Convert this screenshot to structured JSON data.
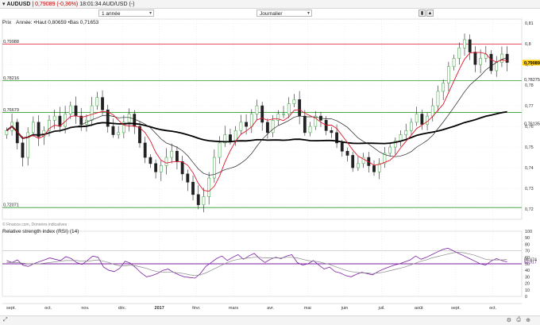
{
  "header": {
    "symbol": "AUDUSD",
    "price": "0,79089",
    "change": "(-0,36%)",
    "time": "18:01:34",
    "instrument": "AUD/USD (-)"
  },
  "toolbar": {
    "period_select": "1 année",
    "interval_select": "Journalier"
  },
  "legend": {
    "label": "Prix",
    "info": "Année: •Haut 0,80659 •Bas 0,71653"
  },
  "watermark": "© Finance.com, Données indicatives",
  "rsi_title": "Relative strength index (RSI) (14)",
  "colors": {
    "candle_up": "#4caf50",
    "candle_down": "#222222",
    "ma_fast": "#e0162b",
    "ma_mid": "#222222",
    "ma_slow": "#000000",
    "support_line": "#2e9b2e",
    "resistance_line": "#e0162b",
    "rsi_line": "#7b1fa2",
    "rsi_signal": "#888888",
    "price_badge": "#ffcc00",
    "ma_badge": "#e0162b"
  },
  "chart_data": [
    {
      "type": "candlestick",
      "title": "AUDUSD",
      "x_labels": [
        "sept.",
        "oct.",
        "nov.",
        "déc.",
        "2017",
        "févr.",
        "mars",
        "avr.",
        "mai",
        "juin",
        "juil.",
        "août",
        "sept.",
        "oct."
      ],
      "y_ticks": [
        "0,81",
        "0,8",
        "0,79",
        "0,78",
        "0,77",
        "0,76",
        "0,75",
        "0,74",
        "0,73",
        "0,72"
      ],
      "ylim": [
        0.715,
        0.812
      ],
      "hlines": [
        {
          "value": 0.79988,
          "label": "0,79988",
          "color": "resistance"
        },
        {
          "value": 0.78216,
          "label": "0,78216",
          "color": "support"
        },
        {
          "value": 0.76679,
          "label": "0,76679",
          "color": "support"
        },
        {
          "value": 0.72071,
          "label": "0,72071",
          "color": "support"
        }
      ],
      "right_badges": [
        {
          "value": 0.79146,
          "label": "0,79146",
          "kind": "ma"
        },
        {
          "value": 0.79089,
          "label": "0,79089",
          "kind": "price"
        },
        {
          "value": 0.78275,
          "label": "0,78275",
          "kind": "plain"
        },
        {
          "value": 0.76135,
          "label": "0,76135",
          "kind": "plain"
        }
      ],
      "closes": [
        0.758,
        0.762,
        0.752,
        0.745,
        0.757,
        0.762,
        0.755,
        0.758,
        0.763,
        0.765,
        0.76,
        0.766,
        0.77,
        0.765,
        0.761,
        0.763,
        0.77,
        0.774,
        0.768,
        0.76,
        0.756,
        0.757,
        0.762,
        0.766,
        0.76,
        0.752,
        0.745,
        0.742,
        0.738,
        0.741,
        0.745,
        0.748,
        0.743,
        0.737,
        0.733,
        0.727,
        0.722,
        0.726,
        0.735,
        0.745,
        0.752,
        0.756,
        0.753,
        0.758,
        0.762,
        0.76,
        0.766,
        0.77,
        0.762,
        0.757,
        0.763,
        0.766,
        0.766,
        0.771,
        0.773,
        0.765,
        0.757,
        0.76,
        0.765,
        0.763,
        0.758,
        0.757,
        0.752,
        0.748,
        0.746,
        0.74,
        0.742,
        0.745,
        0.741,
        0.738,
        0.742,
        0.747,
        0.75,
        0.753,
        0.756,
        0.758,
        0.762,
        0.766,
        0.761,
        0.765,
        0.77,
        0.777,
        0.781,
        0.789,
        0.793,
        0.798,
        0.802,
        0.796,
        0.79,
        0.793,
        0.795,
        0.787,
        0.791,
        0.795,
        0.791
      ]
    },
    {
      "type": "line",
      "title": "Relative strength index (RSI) (14)",
      "y_ticks": [
        "100",
        "90",
        "80",
        "70",
        "60",
        "50",
        "40",
        "30",
        "20",
        "10",
        "0"
      ],
      "ylim": [
        0,
        100
      ],
      "hlines": [
        {
          "value": 70
        },
        {
          "value": 50,
          "highlight": true
        }
      ],
      "right_badges": [
        {
          "value": 56.674,
          "label": "56,674"
        },
        {
          "value": 52.917,
          "label": "52,917",
          "highlight": true
        }
      ],
      "series": [
        {
          "kind": "rsi",
          "values": [
            55,
            52,
            56,
            48,
            46,
            50,
            53,
            56,
            59,
            57,
            55,
            61,
            58,
            52,
            49,
            55,
            62,
            60,
            45,
            40,
            38,
            43,
            54,
            51,
            44,
            36,
            30,
            32,
            35,
            40,
            42,
            37,
            33,
            30,
            29,
            28,
            35,
            46,
            52,
            58,
            62,
            55,
            60,
            64,
            57,
            62,
            66,
            58,
            52,
            57,
            60,
            58,
            62,
            64,
            52,
            48,
            50,
            55,
            48,
            42,
            45,
            38,
            36,
            32,
            30,
            34,
            37,
            35,
            33,
            38,
            42,
            45,
            48,
            50,
            53,
            56,
            62,
            57,
            60,
            64,
            68,
            72,
            74,
            70,
            66,
            62,
            58,
            54,
            50,
            48,
            54,
            58,
            55,
            53
          ]
        },
        {
          "kind": "signal",
          "values": [
            52,
            52,
            52,
            51,
            50,
            50,
            50,
            51,
            52,
            53,
            54,
            55,
            55,
            55,
            54,
            54,
            55,
            56,
            54,
            52,
            49,
            47,
            47,
            48,
            47,
            45,
            43,
            40,
            38,
            37,
            37,
            37,
            36,
            35,
            33,
            32,
            33,
            36,
            40,
            44,
            48,
            52,
            55,
            57,
            58,
            59,
            60,
            60,
            59,
            59,
            59,
            59,
            60,
            60,
            59,
            57,
            55,
            54,
            53,
            51,
            49,
            46,
            43,
            40,
            38,
            37,
            36,
            36,
            35,
            36,
            37,
            39,
            41,
            43,
            45,
            48,
            51,
            54,
            56,
            59,
            61,
            63,
            65,
            67,
            68,
            67,
            65,
            63,
            60,
            57,
            56,
            56,
            56,
            57
          ]
        }
      ]
    }
  ]
}
